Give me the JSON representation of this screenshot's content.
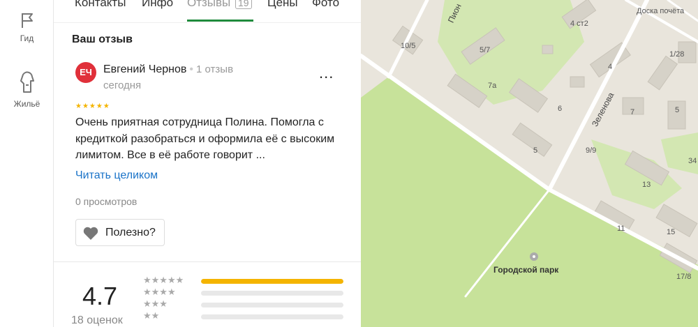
{
  "rail": {
    "items": [
      {
        "label": "Гид",
        "icon": "flag-icon"
      },
      {
        "label": "Жильё",
        "icon": "house-icon"
      }
    ]
  },
  "tabs": [
    {
      "label": "Контакты"
    },
    {
      "label": "Инфо"
    },
    {
      "label": "Отзывы",
      "count": "19",
      "active": true
    },
    {
      "label": "Цены"
    },
    {
      "label": "Фото"
    }
  ],
  "review": {
    "section_title": "Ваш отзыв",
    "avatar_initials": "ЕЧ",
    "author": "Евгений Чернов",
    "author_reviews": "1 отзыв",
    "date": "сегодня",
    "more_label": "...",
    "stars": "★★★★★",
    "rating": 5,
    "text": "Очень приятная сотрудница Полина. Помогла с кредиткой разобраться и оформила её с высоким лимитом. Все в её работе говорит ...",
    "read_more": "Читать целиком",
    "views": "0 просмотров",
    "useful_label": "Полезно?"
  },
  "summary": {
    "rating": "4.7",
    "count": "18 оценок",
    "distribution": [
      {
        "stars": "★★★★★",
        "fraction": 1.0
      },
      {
        "stars": "★★★★",
        "fraction": 0.0
      },
      {
        "stars": "★★★",
        "fraction": 0.0
      },
      {
        "stars": "★★",
        "fraction": 0.0
      }
    ]
  },
  "map": {
    "street_labels": [
      "Пион",
      "Зеленова"
    ],
    "building_labels": [
      "10/5",
      "5/7",
      "7а",
      "6",
      "5",
      "4 ст2",
      "4",
      "7",
      "5",
      "1/28",
      "9/9",
      "13",
      "11",
      "15",
      "17/8",
      "34",
      "Доска почёта"
    ],
    "park_label": "Городской парк",
    "colors": {
      "land": "#e9e5dc",
      "park": "#c7e29a",
      "road": "#ffffff"
    }
  }
}
